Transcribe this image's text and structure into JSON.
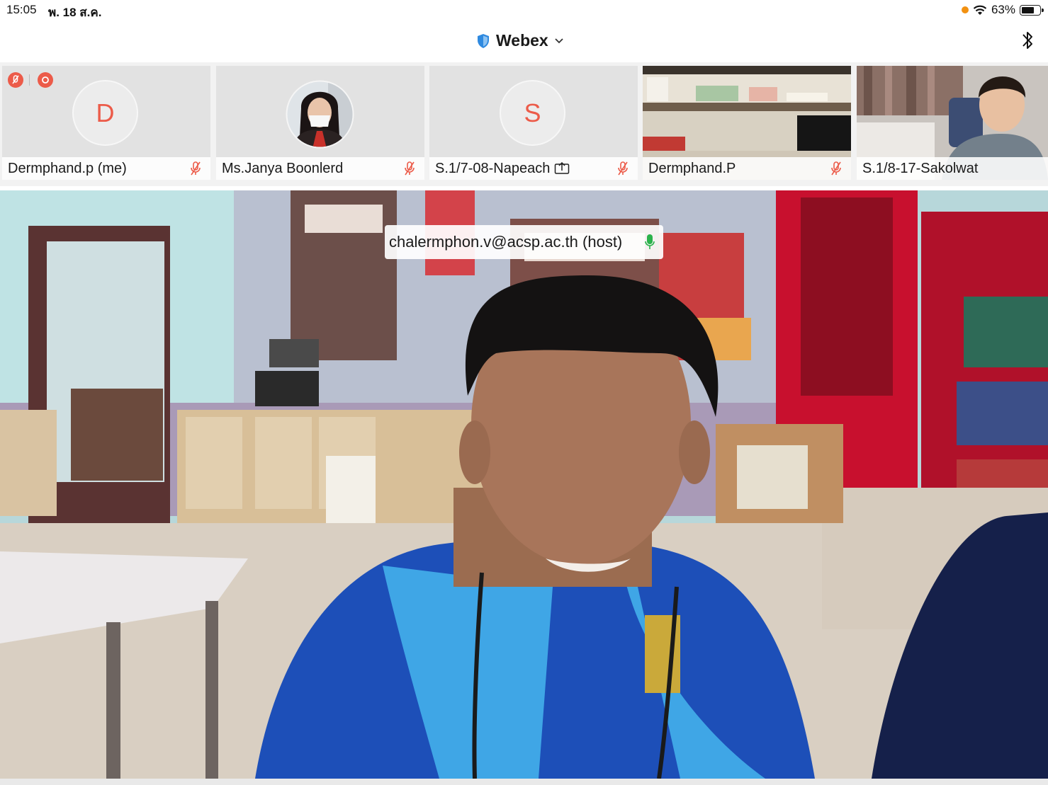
{
  "status_bar": {
    "time": "15:05",
    "date": "พ. 18 ส.ค.",
    "battery": "63%",
    "icons": [
      "orange-dot-icon",
      "wifi-icon",
      "battery-icon"
    ]
  },
  "header": {
    "title": "Webex",
    "icons": [
      "shield-icon",
      "chevron-down-icon",
      "bluetooth-icon"
    ]
  },
  "participants": [
    {
      "name": "Dermphand.p (me)",
      "avatar": "D",
      "muted": true
    },
    {
      "name": "Ms.Janya Boonlerd",
      "avatar": "photo",
      "muted": true
    },
    {
      "name": "S.1/7-08-Napeach",
      "avatar": "S",
      "muted": true,
      "sharing": true
    },
    {
      "name": "Dermphand.P",
      "avatar": "video",
      "muted": true
    },
    {
      "name": "S.1/8-17-Sakolwat",
      "avatar": "video",
      "muted": true
    }
  ],
  "main_video": {
    "speaker_label": "chalermphon.v@acsp.ac.th (host)",
    "mic_icon": "mic-active-icon"
  },
  "colors": {
    "accent_red": "#ec5b49",
    "mic_green": "#2bb24c",
    "webex_blue": "#2f8ae0"
  }
}
